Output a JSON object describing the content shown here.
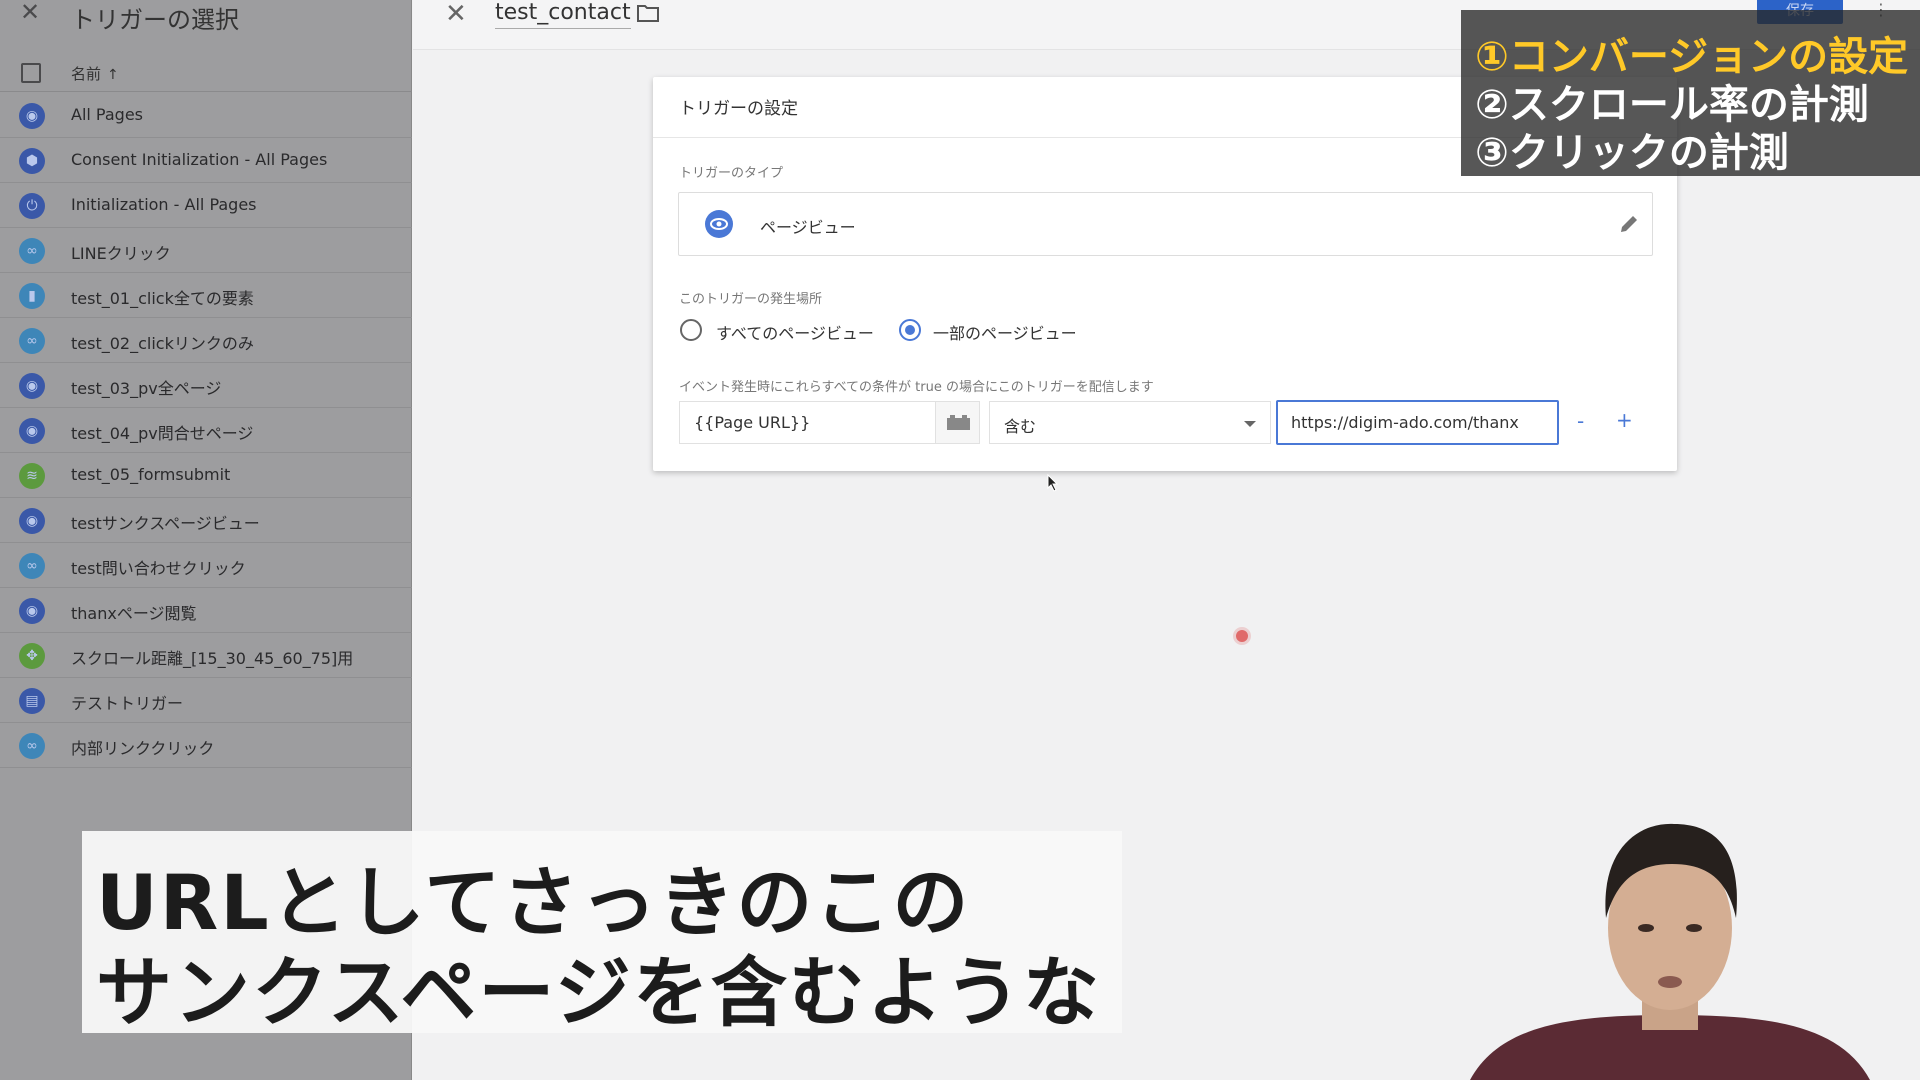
{
  "left_panel": {
    "title": "トリガーの選択",
    "column_header": "名前",
    "sort_indicator": "↑",
    "triggers": [
      {
        "label": "All Pages",
        "icon": "eye-icon",
        "color": "#3a58a8"
      },
      {
        "label": "Consent Initialization - All Pages",
        "icon": "shield-icon",
        "color": "#3a58a8"
      },
      {
        "label": "Initialization - All Pages",
        "icon": "power-icon",
        "color": "#3a58a8"
      },
      {
        "label": "LINEクリック",
        "icon": "link-icon",
        "color": "#3e86b8"
      },
      {
        "label": "test_01_click全ての要素",
        "icon": "mouse-icon",
        "color": "#3e86b8"
      },
      {
        "label": "test_02_clickリンクのみ",
        "icon": "link-icon",
        "color": "#3e86b8"
      },
      {
        "label": "test_03_pv全ページ",
        "icon": "eye-icon",
        "color": "#3a58a8"
      },
      {
        "label": "test_04_pv問合せページ",
        "icon": "eye-icon",
        "color": "#3a58a8"
      },
      {
        "label": "test_05_formsubmit",
        "icon": "form-icon",
        "color": "#5c9a3e"
      },
      {
        "label": "testサンクスページビュー",
        "icon": "eye-icon",
        "color": "#3a58a8"
      },
      {
        "label": "test問い合わせクリック",
        "icon": "link-icon",
        "color": "#3e86b8"
      },
      {
        "label": "thanxページ閲覧",
        "icon": "eye-icon",
        "color": "#3a58a8"
      },
      {
        "label": "スクロール距離_[15_30_45_60_75]用",
        "icon": "scroll-icon",
        "color": "#5c9a3e"
      },
      {
        "label": "テストトリガー",
        "icon": "document-icon",
        "color": "#3a58a8"
      },
      {
        "label": "内部リンククリック",
        "icon": "link-icon",
        "color": "#3e86b8"
      }
    ]
  },
  "topbar": {
    "trigger_name": "test_contact",
    "save_label": "保存"
  },
  "card": {
    "title": "トリガーの設定",
    "type_label": "トリガーのタイプ",
    "type_value": "ページビュー",
    "where_label": "このトリガーの発生場所",
    "radio_all": "すべてのページビュー",
    "radio_some": "一部のページビュー",
    "selected_radio": "radio_some",
    "condition_label": "イベント発生時にこれらすべての条件が true の場合にこのトリガーを配信します",
    "condition": {
      "variable": "{{Page URL}}",
      "operator": "含む",
      "value": "https://digim-ado.com/thanx"
    },
    "minus": "-",
    "plus": "+"
  },
  "agenda": {
    "items": [
      "①コンバージョンの設定",
      "②スクロール率の計測",
      "③クリックの計測"
    ],
    "highlight_color": "#ffc928"
  },
  "subtitle": {
    "line1": "URLとしてさっきのこの",
    "line2": "サンクスページを含むような"
  },
  "colors": {
    "accent": "#4a78d6",
    "save_button": "#2c63c8"
  }
}
